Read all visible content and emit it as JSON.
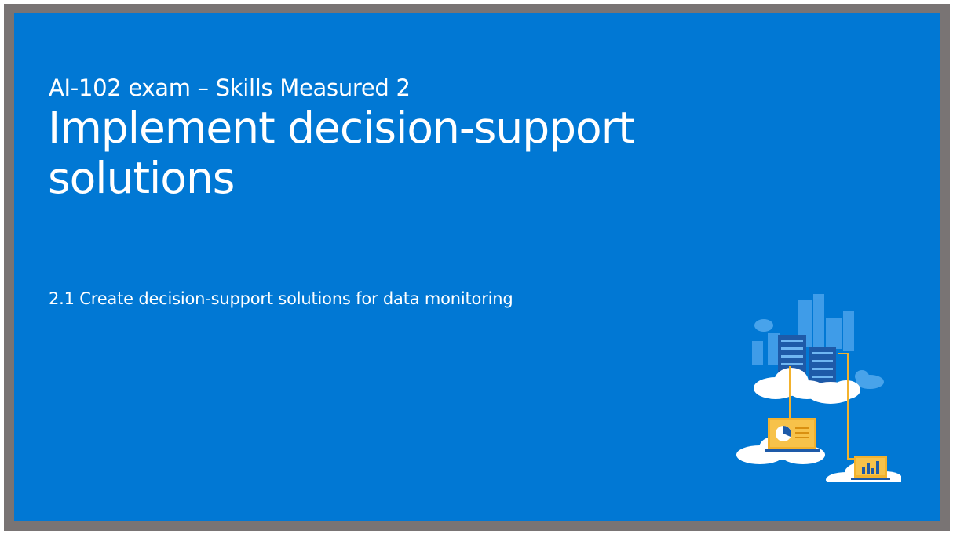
{
  "slide": {
    "subtitle": "AI-102 exam – Skills Measured 2",
    "title": "Implement decision-support solutions",
    "objective": "2.1 Create decision-support solutions for data monitoring"
  },
  "colors": {
    "background": "#0178d4",
    "frame": "#797474",
    "text": "#ffffff",
    "accent_orange": "#f3b22d",
    "cloud": "#ffffff",
    "server": "#1e5aa8"
  },
  "illustration": {
    "icon": "cloud-data-monitoring-illustration"
  }
}
